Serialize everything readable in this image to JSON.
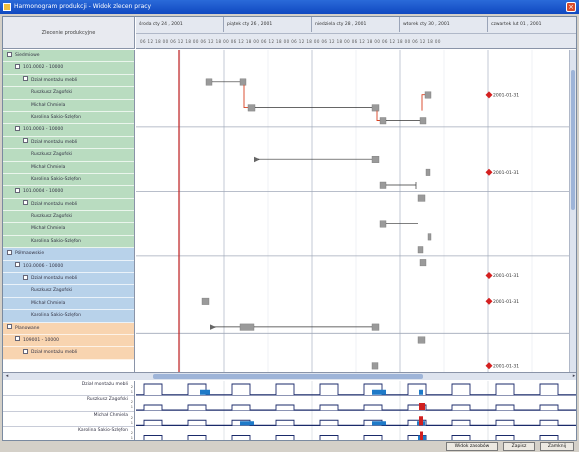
{
  "window": {
    "title": "Harmonogram produkcji - Widok zlecen pracy"
  },
  "column_header": "Zlecenie produkcyjne",
  "timeline": {
    "days": [
      "środa cty 24 , 2001",
      "piątek cty 26 , 2001",
      "niedziela cty 28 , 2001",
      "wtorek cty 30 , 2001",
      "czwartek lut 01 , 2001"
    ],
    "hours_label": "06 12 18 00 06 12 18 00 06 12 18 00 06 12 18 00 06 12 18 00 06 12 18 00 06 12 18 00 06 12 18 00 06 12 18 00 06 12 18 00"
  },
  "rows": [
    {
      "label": "Siedmiowe",
      "indent": 0,
      "tone": "g",
      "exp": true
    },
    {
      "label": "101.0002 - 10000",
      "indent": 1,
      "tone": "g",
      "exp": true
    },
    {
      "label": "Dział montażu mebli",
      "indent": 2,
      "tone": "g",
      "exp": true
    },
    {
      "label": "Ruszkusz Zagofski",
      "indent": 3,
      "tone": "g",
      "exp": false
    },
    {
      "label": "Michał Chmiela",
      "indent": 3,
      "tone": "g",
      "exp": false
    },
    {
      "label": "Karolina Sakio-Szlęfon",
      "indent": 3,
      "tone": "g",
      "exp": false
    },
    {
      "label": "101.0003 - 10000",
      "indent": 1,
      "tone": "g",
      "exp": true
    },
    {
      "label": "Dział montażu mebli",
      "indent": 2,
      "tone": "g",
      "exp": true
    },
    {
      "label": "Ruszkusz Zagofski",
      "indent": 3,
      "tone": "g",
      "exp": false
    },
    {
      "label": "Michał Chmiela",
      "indent": 3,
      "tone": "g",
      "exp": false
    },
    {
      "label": "Karolina Sakio-Szlęfon",
      "indent": 3,
      "tone": "g",
      "exp": false
    },
    {
      "label": "101.0004 - 10000",
      "indent": 1,
      "tone": "g",
      "exp": true
    },
    {
      "label": "Dział montażu mebli",
      "indent": 2,
      "tone": "g",
      "exp": true
    },
    {
      "label": "Ruszkusz Zagofski",
      "indent": 3,
      "tone": "g",
      "exp": false
    },
    {
      "label": "Michał Chmiela",
      "indent": 3,
      "tone": "g",
      "exp": false
    },
    {
      "label": "Karolina Sakio-Szlęfon",
      "indent": 3,
      "tone": "g",
      "exp": false
    },
    {
      "label": "Półmaowskie",
      "indent": 0,
      "tone": "b",
      "exp": true
    },
    {
      "label": "103.0006 - 10000",
      "indent": 1,
      "tone": "b",
      "exp": true
    },
    {
      "label": "Dział montażu mebli",
      "indent": 2,
      "tone": "b",
      "exp": true
    },
    {
      "label": "Ruszkusz Zagofski",
      "indent": 3,
      "tone": "b",
      "exp": false
    },
    {
      "label": "Michał Chmiela",
      "indent": 3,
      "tone": "b",
      "exp": false
    },
    {
      "label": "Karolina Sakio-Szlęfon",
      "indent": 3,
      "tone": "b",
      "exp": false
    },
    {
      "label": "Planowane",
      "indent": 0,
      "tone": "o",
      "exp": true
    },
    {
      "label": "109001 - 10000",
      "indent": 1,
      "tone": "o",
      "exp": true
    },
    {
      "label": "Dział montażu mebli",
      "indent": 2,
      "tone": "o",
      "exp": true
    }
  ],
  "milestones": [
    "2001-01-31",
    "2001-01-31",
    "2001-01-31",
    "2001-01-31",
    "2001-01-31"
  ],
  "load_rows": [
    {
      "label": "Dział montażu mebli",
      "scale": [
        "2",
        "1"
      ]
    },
    {
      "label": "Ruszkusz Zagofski",
      "scale": [
        "2",
        "1"
      ]
    },
    {
      "label": "Michał Chmiela",
      "scale": [
        "2",
        "1"
      ]
    },
    {
      "label": "Karolina Sakio-Szlęfon",
      "scale": [
        "2",
        "1"
      ]
    }
  ],
  "buttons": {
    "view": "Widok zasobów",
    "save": "Zapisz",
    "close": "Zamknij"
  },
  "colors": {
    "accent": "#1f7ac8",
    "milestone": "#d42020",
    "today_line": "#c02020",
    "bar": "#9a9a9a"
  }
}
